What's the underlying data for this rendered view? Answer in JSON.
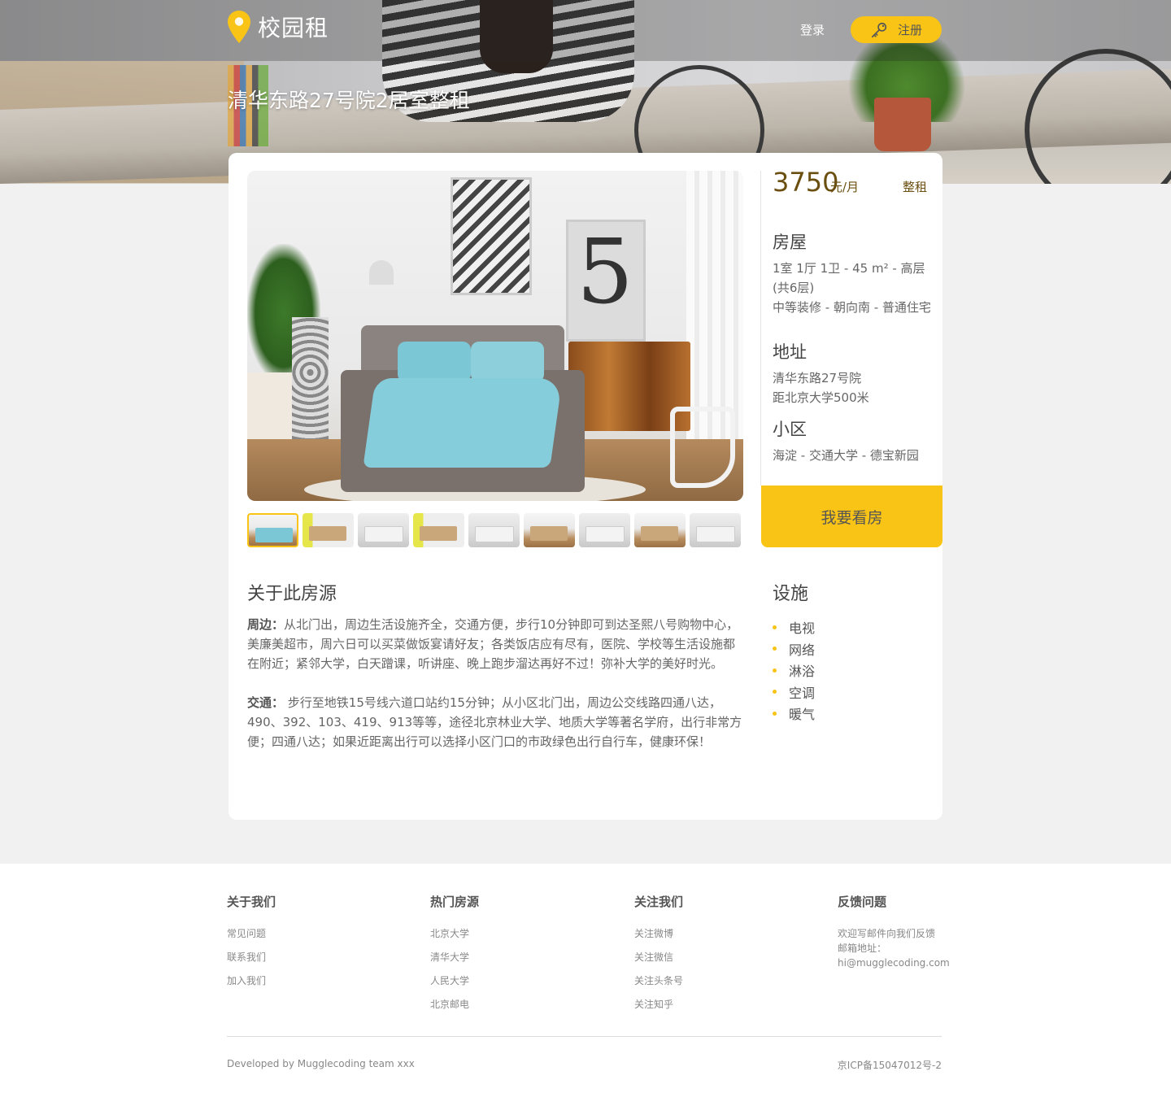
{
  "header": {
    "brand": "校园租",
    "login_label": "登录",
    "register_label": "注册",
    "listing_title": "清华东路27号院2居室整租"
  },
  "colors": {
    "accent": "#f9c416",
    "price_text": "#6b4f10",
    "page_bg": "#f1f1f1"
  },
  "icons": {
    "logo": "location-pin-icon",
    "register": "key-icon",
    "list_bullet": "dot-icon"
  },
  "gallery": {
    "thumbnail_count": 9,
    "active_index": 0
  },
  "pricing": {
    "amount": "3750",
    "unit": "元/月",
    "rent_type": "整租"
  },
  "house": {
    "heading": "房屋",
    "line1": "1室 1厅 1卫  - 45 m²  - 高层(共6层)",
    "line2": "中等装修  - 朝向南  - 普通住宅"
  },
  "address": {
    "heading": "地址",
    "line1": "清华东路27号院",
    "line2": "距北京大学500米"
  },
  "community": {
    "heading": "小区",
    "line1": "海淀 -  交通大学 -  德宝新园"
  },
  "cta_label": "我要看房",
  "about": {
    "heading": "关于此房源",
    "surroundings_label": "周边：",
    "surroundings_text": "从北门出，周边生活设施齐全，交通方便，步行10分钟即可到达圣熙八号购物中心，美廉美超市，周六日可以买菜做饭宴请好友；各类饭店应有尽有，医院、学校等生活设施都在附近；紧邻大学，白天蹭课，听讲座、晚上跑步溜达再好不过！弥补大学的美好时光。",
    "transport_label": "交通：",
    "transport_text": " 步行至地铁15号线六道口站约15分钟；从小区北门出，周边公交线路四通八达，490、392、103、419、913等等，途径北京林业大学、地质大学等著名学府，出行非常方便；四通八达；如果近距离出行可以选择小区门口的市政绿色出行自行车，健康环保！"
  },
  "facilities": {
    "heading": "设施",
    "items": [
      "电视",
      "网络",
      "淋浴",
      "空调",
      "暖气"
    ]
  },
  "footer": {
    "col1": {
      "heading": "关于我们",
      "links": [
        "常见问题",
        "联系我们",
        "加入我们"
      ]
    },
    "col2": {
      "heading": "热门房源",
      "links": [
        "北京大学",
        "清华大学",
        "人民大学",
        "北京邮电"
      ]
    },
    "col3": {
      "heading": "关注我们",
      "links": [
        "关注微博",
        "关注微信",
        "关注头条号",
        "关注知乎"
      ]
    },
    "col4": {
      "heading": "反馈问题",
      "line1": "欢迎写邮件向我们反馈",
      "line2": "邮箱地址：",
      "email": "hi@mugglecoding.com"
    },
    "developed_by": "Developed by Mugglecoding team xxx",
    "icp": "京ICP备15047012号-2"
  }
}
